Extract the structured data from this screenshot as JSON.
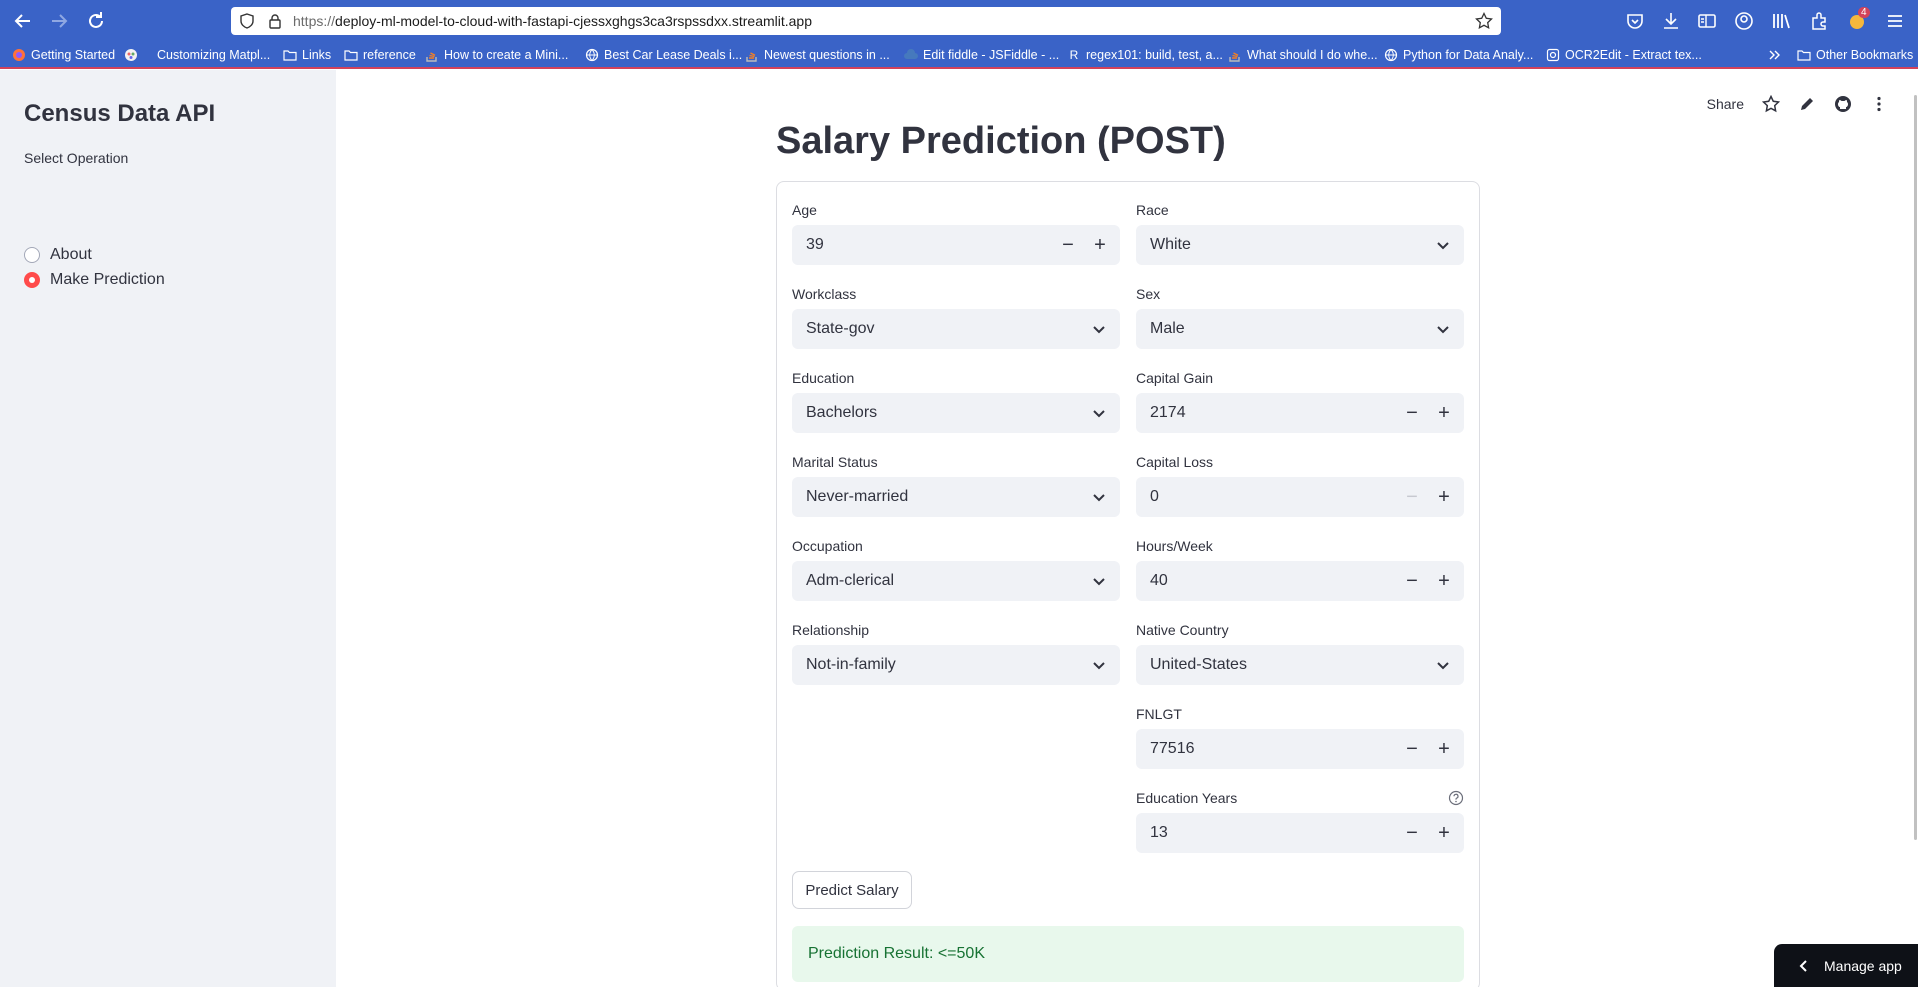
{
  "browser": {
    "url_scheme": "https://",
    "url_rest": "deploy-ml-model-to-cloud-with-fastapi-cjessxghgs3ca3rspssdxx.streamlit.app",
    "download_badge": "4",
    "bookmarks": [
      {
        "label": "Getting Started",
        "icon": "firefox-icon"
      },
      {
        "label": "",
        "icon": "colorwheel-icon"
      },
      {
        "label": "Customizing Matpl...",
        "icon": "none"
      },
      {
        "label": "Links",
        "icon": "folder-icon"
      },
      {
        "label": "reference",
        "icon": "folder-icon"
      },
      {
        "label": "How to create a Mini...",
        "icon": "stackoverflow-icon"
      },
      {
        "label": "Best Car Lease Deals i...",
        "icon": "globe-icon"
      },
      {
        "label": "Newest questions in ...",
        "icon": "stackoverflow-icon"
      },
      {
        "label": "Edit fiddle - JSFiddle - ...",
        "icon": "jsfiddle-icon"
      },
      {
        "label": "regex101: build, test, a...",
        "icon": "regex-icon"
      },
      {
        "label": "What should I do whe...",
        "icon": "stackoverflow-icon"
      },
      {
        "label": "Python for Data Analy...",
        "icon": "globe-icon"
      },
      {
        "label": "OCR2Edit - Extract tex...",
        "icon": "ocr-icon"
      }
    ],
    "other_bookmarks": "Other Bookmarks"
  },
  "sidebar": {
    "title": "Census Data API",
    "radio_label": "Select Operation",
    "options": [
      {
        "label": "About",
        "checked": false
      },
      {
        "label": "Make Prediction",
        "checked": true
      }
    ]
  },
  "header": {
    "share": "Share"
  },
  "main": {
    "title": "Salary Prediction (POST)"
  },
  "form": {
    "age": {
      "label": "Age",
      "value": "39"
    },
    "race": {
      "label": "Race",
      "value": "White"
    },
    "workclass": {
      "label": "Workclass",
      "value": "State-gov"
    },
    "sex": {
      "label": "Sex",
      "value": "Male"
    },
    "education": {
      "label": "Education",
      "value": "Bachelors"
    },
    "capital_gain": {
      "label": "Capital Gain",
      "value": "2174"
    },
    "marital_status": {
      "label": "Marital Status",
      "value": "Never-married"
    },
    "capital_loss": {
      "label": "Capital Loss",
      "value": "0"
    },
    "occupation": {
      "label": "Occupation",
      "value": "Adm-clerical"
    },
    "hours_week": {
      "label": "Hours/Week",
      "value": "40"
    },
    "relationship": {
      "label": "Relationship",
      "value": "Not-in-family"
    },
    "native_country": {
      "label": "Native Country",
      "value": "United-States"
    },
    "fnlgt": {
      "label": "FNLGT",
      "value": "77516"
    },
    "education_years": {
      "label": "Education Years",
      "value": "13"
    },
    "submit": "Predict Salary"
  },
  "result": {
    "text": "Prediction Result: <=50K"
  },
  "manage_app": "Manage app",
  "colors": {
    "browser_chrome": "#3a63c7",
    "accent": "#ff4b4b",
    "sidebar_bg": "#f0f2f6",
    "success_bg": "#e8f8ec",
    "success_text": "#177233"
  }
}
